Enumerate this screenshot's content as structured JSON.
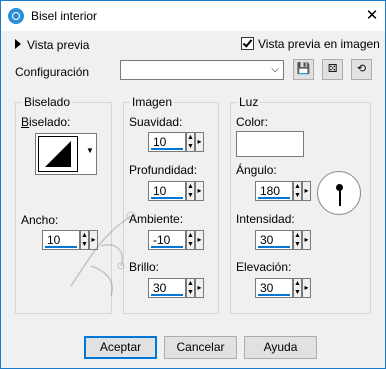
{
  "window": {
    "title": "Bisel interior"
  },
  "header": {
    "preview_toggle_label": "Vista previa",
    "preview_in_image_label": "Vista previa en imagen",
    "preview_in_image_checked": true
  },
  "config": {
    "label": "Configuración",
    "preset_value": ""
  },
  "groups": {
    "biselado": {
      "title": "Biselado",
      "shape_label": "Biselado:",
      "width_label": "Ancho:",
      "width_value": "10"
    },
    "imagen": {
      "title": "Imagen",
      "smoothness_label": "Suavidad:",
      "smoothness_value": "10",
      "depth_label": "Profundidad:",
      "depth_value": "10",
      "ambience_label": "Ambiente:",
      "ambience_value": "-10",
      "brightness_label": "Brillo:",
      "brightness_value": "30"
    },
    "luz": {
      "title": "Luz",
      "color_label": "Color:",
      "color_value": "#ffffff",
      "angle_label": "Ángulo:",
      "angle_value": "180",
      "intensity_label": "Intensidad:",
      "intensity_value": "30",
      "elevation_label": "Elevación:",
      "elevation_value": "30"
    }
  },
  "footer": {
    "accept_label": "Aceptar",
    "cancel_label": "Cancelar",
    "help_label": "Ayuda"
  }
}
